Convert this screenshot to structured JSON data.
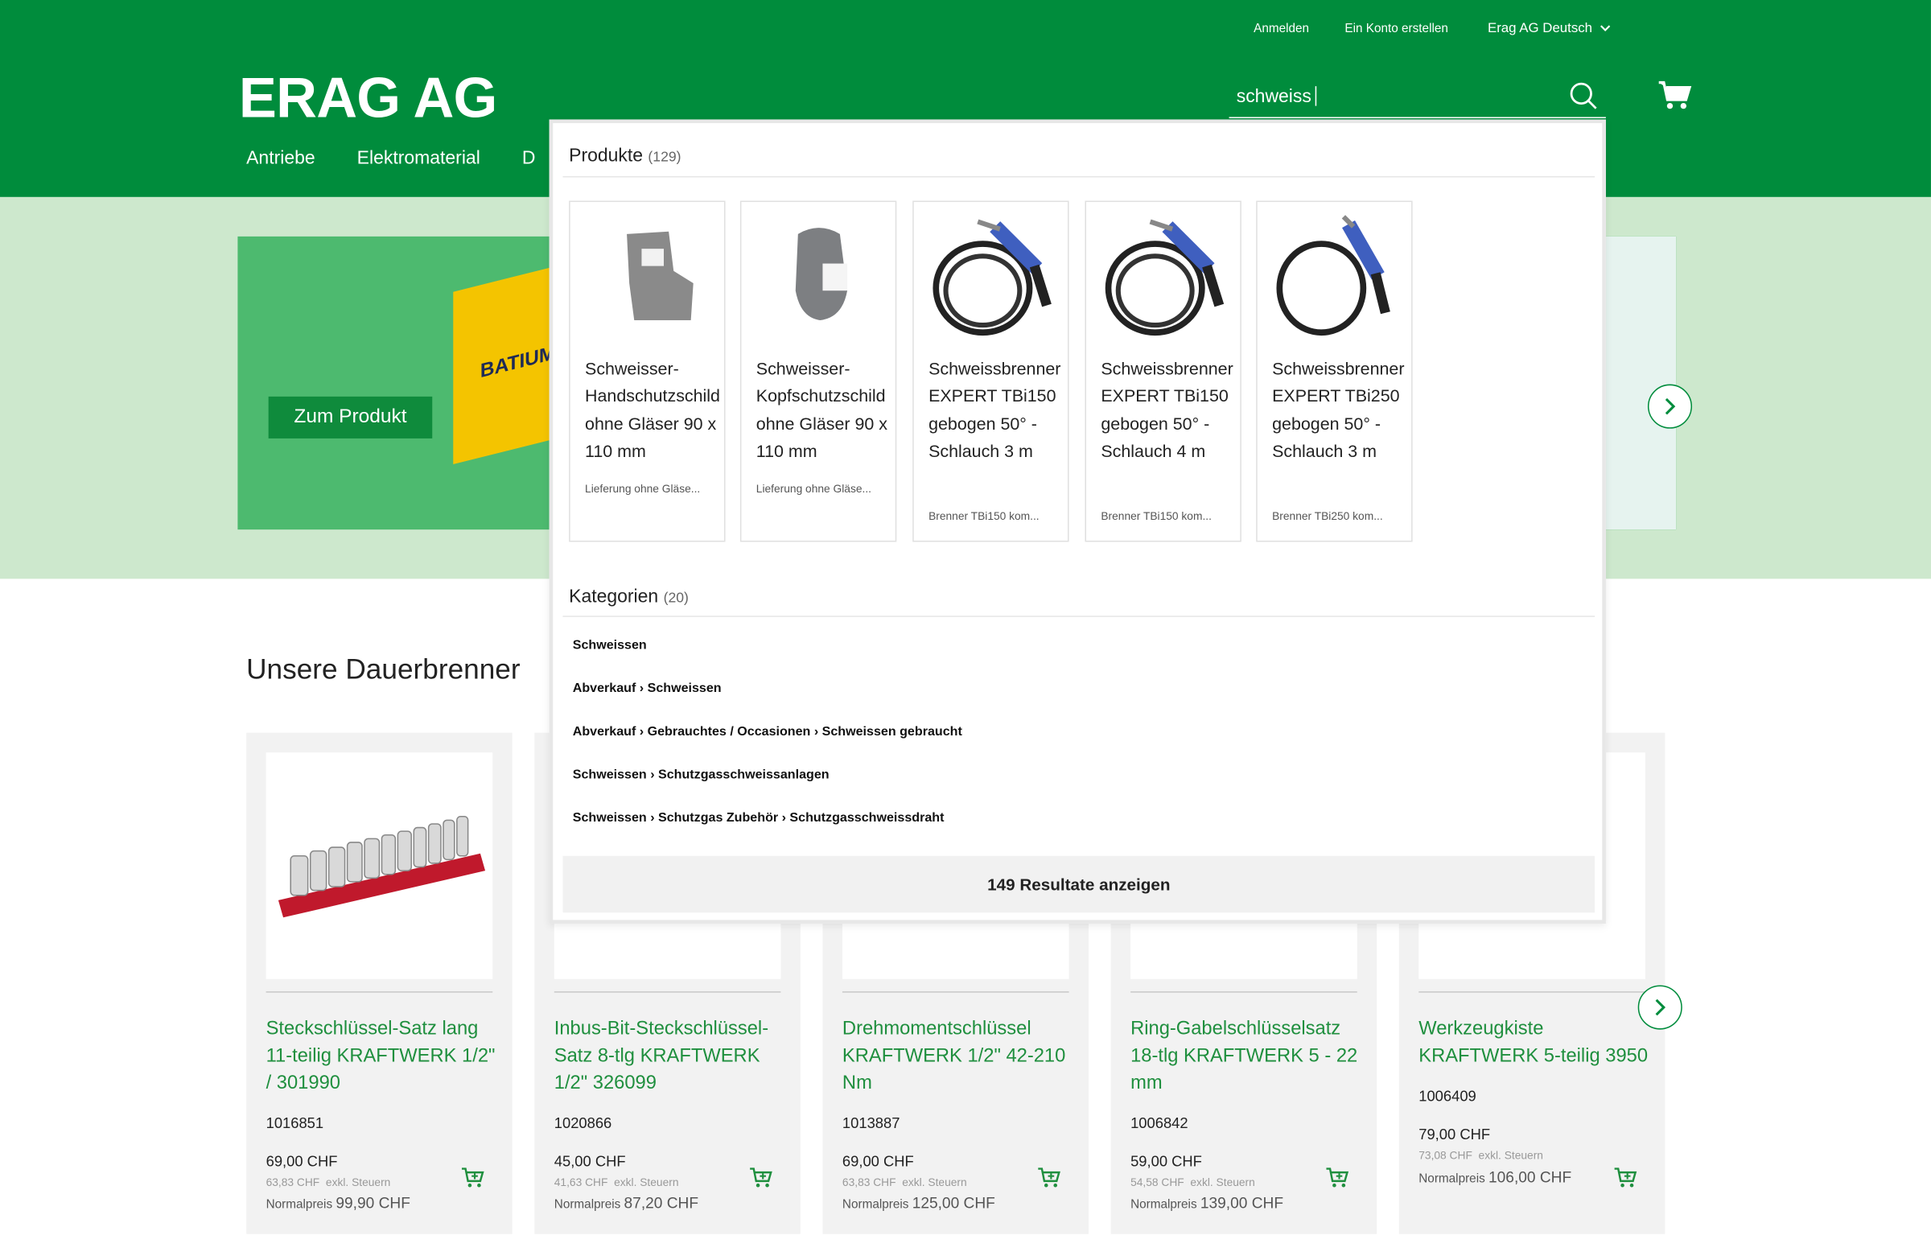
{
  "header": {
    "top_links": {
      "login": "Anmelden",
      "register": "Ein Konto erstellen",
      "language": "Erag AG Deutsch"
    },
    "logo": "ERAG AG",
    "nav": [
      "Antriebe",
      "Elektromaterial",
      "D"
    ],
    "search_value": "schweiss"
  },
  "hero": {
    "button": "Zum Produkt",
    "box_label": "BATIUM"
  },
  "section": {
    "title": "Unsere Dauerbrenner"
  },
  "products": [
    {
      "name": "Steckschlüssel-Satz lang 11-teilig KRAFTWERK 1/2\" / 301990",
      "sku": "1016851",
      "price": "69,00 CHF",
      "tax_price": "63,83 CHF",
      "tax_label": "exkl. Steuern",
      "normal_label": "Normalpreis",
      "normal_price": "99,90 CHF"
    },
    {
      "name": "Inbus-Bit-Steckschlüssel-Satz 8-tlg KRAFTWERK 1/2\" 326099",
      "sku": "1020866",
      "price": "45,00 CHF",
      "tax_price": "41,63 CHF",
      "tax_label": "exkl. Steuern",
      "normal_label": "Normalpreis",
      "normal_price": "87,20 CHF"
    },
    {
      "name": "Drehmomentschlüssel KRAFTWERK 1/2\" 42-210 Nm",
      "sku": "1013887",
      "price": "69,00 CHF",
      "tax_price": "63,83 CHF",
      "tax_label": "exkl. Steuern",
      "normal_label": "Normalpreis",
      "normal_price": "125,00 CHF"
    },
    {
      "name": "Ring-Gabelschlüsselsatz 18-tlg KRAFTWERK 5 - 22 mm",
      "sku": "1006842",
      "price": "59,00 CHF",
      "tax_price": "54,58 CHF",
      "tax_label": "exkl. Steuern",
      "normal_label": "Normalpreis",
      "normal_price": "139,00 CHF"
    },
    {
      "name": "Werkzeugkiste KRAFTWERK 5-teilig 3950",
      "sku": "1006409",
      "price": "79,00 CHF",
      "tax_price": "73,08 CHF",
      "tax_label": "exkl. Steuern",
      "normal_label": "Normalpreis",
      "normal_price": "106,00 CHF"
    }
  ],
  "dropdown": {
    "products_heading": "Produkte",
    "products_count": "(129)",
    "items": [
      {
        "title": "Schweisser-Handschutzschild ohne Gläser 90 x 110 mm",
        "desc": "Lieferung ohne Gläse..."
      },
      {
        "title": "Schweisser-Kopfschutzschild ohne Gläser 90 x 110 mm",
        "desc": "Lieferung ohne Gläse..."
      },
      {
        "title": "Schweissbrenner EXPERT TBi150 gebogen 50° - Schlauch 3 m",
        "desc": "Brenner TBi150 kom..."
      },
      {
        "title": "Schweissbrenner EXPERT TBi150 gebogen 50° - Schlauch 4 m",
        "desc": "Brenner TBi150 kom..."
      },
      {
        "title": "Schweissbrenner EXPERT TBi250 gebogen 50° - Schlauch 3 m",
        "desc": "Brenner TBi250 kom..."
      }
    ],
    "categories_heading": "Kategorien",
    "categories_count": "(20)",
    "categories": [
      "Schweissen",
      "Abverkauf › Schweissen",
      "Abverkauf › Gebrauchtes / Occasionen › Schweissen gebraucht",
      "Schweissen › Schutzgasschweissanlagen",
      "Schweissen › Schutzgas Zubehör › Schutzgasschweissdraht"
    ],
    "results_button": "149 Resultate anzeigen"
  },
  "colors": {
    "brand_green": "#008c3c",
    "link_green": "#1f8f3e",
    "hero_band": "#cde8cd"
  }
}
